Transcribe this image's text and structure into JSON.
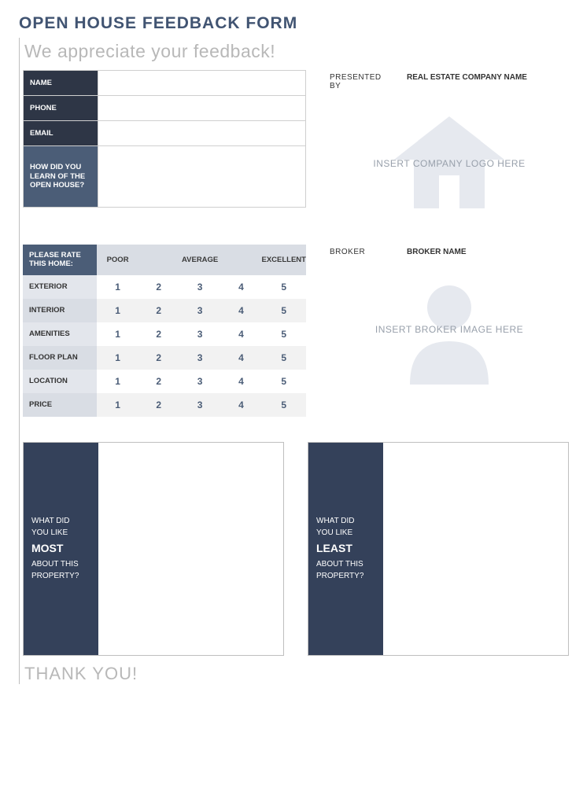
{
  "title": "OPEN HOUSE FEEDBACK FORM",
  "subtitle": "We appreciate your feedback!",
  "contact": {
    "name_label": "NAME",
    "phone_label": "PHONE",
    "email_label": "EMAIL",
    "howlearn_label": "HOW DID YOU LEARN OF THE OPEN HOUSE?",
    "name_value": "",
    "phone_value": "",
    "email_value": "",
    "howlearn_value": ""
  },
  "presented": {
    "label": "PRESENTED BY",
    "value": "REAL ESTATE COMPANY NAME",
    "logo_placeholder": "INSERT COMPANY LOGO HERE"
  },
  "broker": {
    "label": "BROKER",
    "value": "BROKER NAME",
    "image_placeholder": "INSERT BROKER IMAGE HERE"
  },
  "rating": {
    "header": "PLEASE RATE THIS HOME:",
    "scale_poor": "POOR",
    "scale_avg": "AVERAGE",
    "scale_exc": "EXCELLENT",
    "criteria": [
      "EXTERIOR",
      "INTERIOR",
      "AMENITIES",
      "FLOOR PLAN",
      "LOCATION",
      "PRICE"
    ],
    "values": [
      "1",
      "2",
      "3",
      "4",
      "5"
    ]
  },
  "like_most": {
    "line1": "WHAT DID",
    "line2": "YOU LIKE",
    "big": "MOST",
    "line3": "ABOUT THIS",
    "line4": "PROPERTY?",
    "content": ""
  },
  "like_least": {
    "line1": "WHAT DID",
    "line2": "YOU LIKE",
    "big": "LEAST",
    "line3": "ABOUT THIS",
    "line4": "PROPERTY?",
    "content": ""
  },
  "thanks": "THANK YOU!"
}
